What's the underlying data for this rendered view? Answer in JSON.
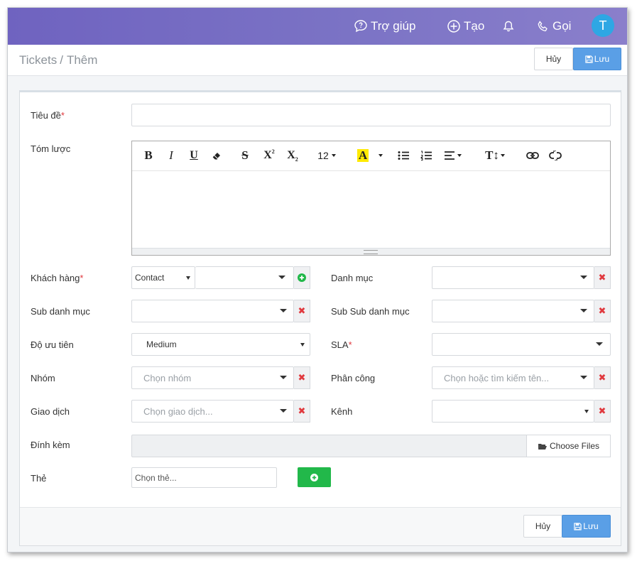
{
  "topbar": {
    "help_label": "Trợ giúp",
    "create_label": "Tạo",
    "call_label": "Gọi",
    "avatar_initial": "T",
    "avatar_color": "#2ea7e4"
  },
  "breadcrumb": {
    "root": "Tickets",
    "separator": "/",
    "current": "Thêm"
  },
  "actions": {
    "cancel_label": "Hủy",
    "save_label": "Lưu"
  },
  "form": {
    "title_label": "Tiêu đề",
    "summary_label": "Tóm lược",
    "editor": {
      "font_size": "12"
    },
    "customer": {
      "label": "Khách hàng",
      "type_value": "Contact"
    },
    "category": {
      "label": "Danh mục"
    },
    "subcategory": {
      "label": "Sub danh mục"
    },
    "subsubcategory": {
      "label": "Sub Sub danh mục"
    },
    "priority": {
      "label": "Độ ưu tiên",
      "value": "Medium"
    },
    "sla": {
      "label": "SLA"
    },
    "group": {
      "label": "Nhóm",
      "placeholder": "Chọn nhóm"
    },
    "assign": {
      "label": "Phân công",
      "placeholder": "Chọn hoặc tìm kiếm tên..."
    },
    "transaction": {
      "label": "Giao dịch",
      "placeholder": "Chọn giao dịch..."
    },
    "channel": {
      "label": "Kênh"
    },
    "attachment": {
      "label": "Đính kèm",
      "button_label": "Choose Files"
    },
    "tags": {
      "label": "Thẻ",
      "placeholder": "Chọn thẻ..."
    },
    "required_mark": "*"
  },
  "colors": {
    "topbar": "#7b73c5",
    "primary": "#5a9fe6",
    "success": "#22b84a",
    "danger": "#e0393e"
  }
}
